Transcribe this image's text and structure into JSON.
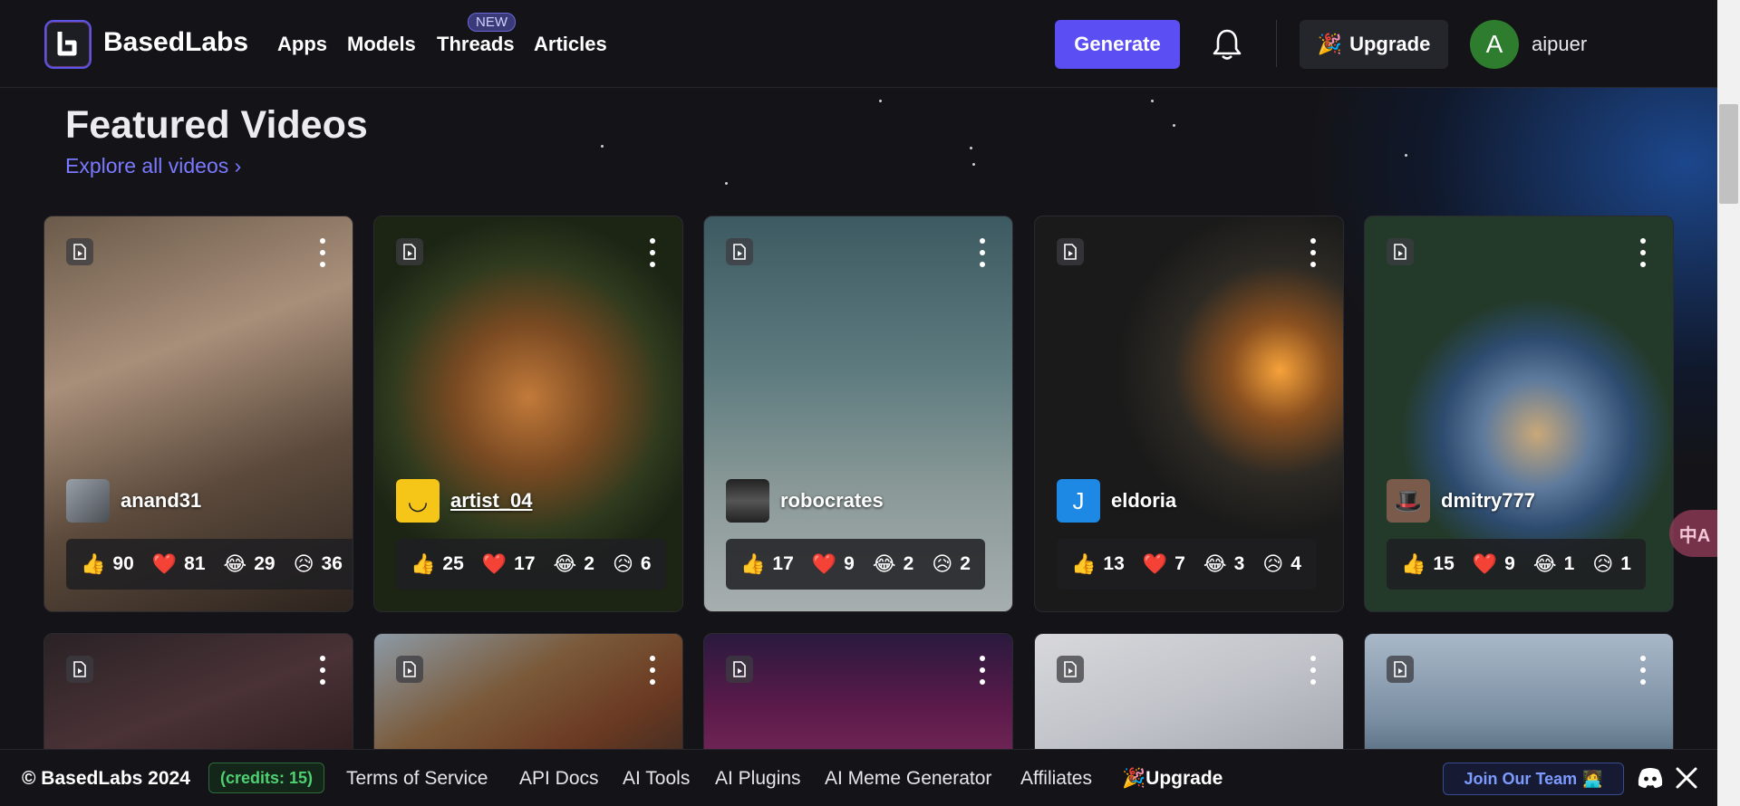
{
  "brand": {
    "name": "BasedLabs"
  },
  "nav": {
    "items": [
      "Apps",
      "Models",
      "Threads",
      "Articles"
    ],
    "new_badge": "NEW"
  },
  "header": {
    "generate_label": "Generate",
    "upgrade_label": "Upgrade",
    "avatar_initial": "A",
    "username": "aipuer"
  },
  "section": {
    "title": "Featured Videos",
    "explore_label": "Explore all videos"
  },
  "cards": [
    {
      "user": "anand31",
      "reactions": {
        "like": "90",
        "heart": "81",
        "laugh": "29",
        "sad": "36"
      }
    },
    {
      "user": "artist_04",
      "reactions": {
        "like": "25",
        "heart": "17",
        "laugh": "2",
        "sad": "6"
      }
    },
    {
      "user": "robocrates",
      "reactions": {
        "like": "17",
        "heart": "9",
        "laugh": "2",
        "sad": "2"
      }
    },
    {
      "user": "eldoria",
      "avatar_initial": "J",
      "reactions": {
        "like": "13",
        "heart": "7",
        "laugh": "3",
        "sad": "4"
      }
    },
    {
      "user": "dmitry777",
      "reactions": {
        "like": "15",
        "heart": "9",
        "laugh": "1",
        "sad": "1"
      }
    }
  ],
  "footer": {
    "copyright": "© BasedLabs 2024",
    "credits": "(credits: 15)",
    "links": [
      "Terms of Service",
      "API Docs",
      "AI Tools",
      "AI Plugins",
      "AI Meme Generator",
      "Affiliates"
    ],
    "upgrade_label": "Upgrade",
    "join_label": "Join Our Team"
  },
  "translate_widget": {
    "glyph": "中A"
  },
  "colors": {
    "accent": "#5b4ef2",
    "link": "#7b79ff",
    "credits": "#4fd071"
  }
}
